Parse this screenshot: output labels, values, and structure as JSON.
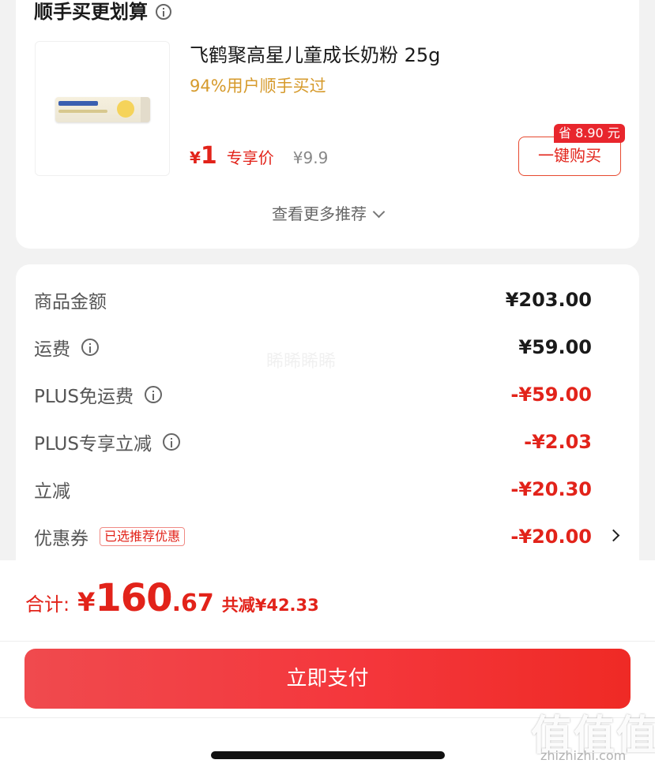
{
  "upsell": {
    "title": "顺手买更划算",
    "product_name": "飞鹤聚高星儿童成长奶粉 25g",
    "bought_hint": "94%用户顺手买过",
    "price_currency": "¥",
    "price": "1",
    "price_tag": "专享价",
    "original_price": "¥9.9",
    "save_badge": "省 8.90 元",
    "buy_label": "一键购买",
    "more_label": "查看更多推荐"
  },
  "summary": {
    "rows": [
      {
        "label": "商品金额",
        "value": "¥203.00"
      },
      {
        "label": "运费",
        "value": "¥59.00"
      },
      {
        "label": "PLUS免运费",
        "value": "-¥59.00"
      },
      {
        "label": "PLUS专享立减",
        "value": "-¥2.03"
      },
      {
        "label": "立减",
        "value": "-¥20.30"
      },
      {
        "label": "优惠券",
        "badge": "已选推荐优惠",
        "value": "-¥20.00"
      }
    ],
    "watermark": "睎睎睎睎"
  },
  "footer": {
    "total_label": "合计:",
    "currency": "¥",
    "total_int": "160",
    "total_dec": ".67",
    "saved": "共减¥42.33",
    "pay_label": "立即支付",
    "site_logo": "值值值",
    "site_url": "zhizhizhi.com"
  },
  "colors": {
    "accent_red": "#e2231a",
    "hint_gold": "#d69a2b",
    "pay_button": "#f04a4e"
  }
}
